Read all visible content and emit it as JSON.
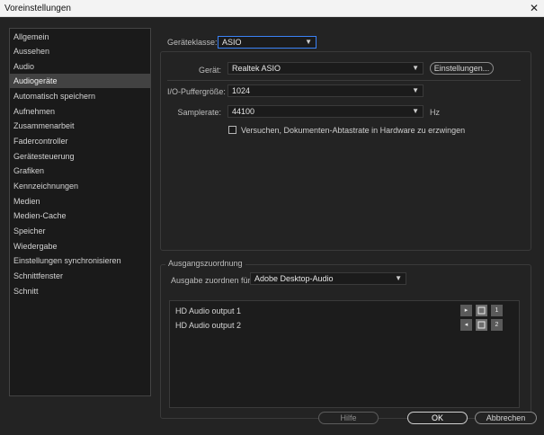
{
  "window": {
    "title": "Voreinstellungen",
    "close_glyph": "✕"
  },
  "sidebar": {
    "selected_index": 3,
    "items": [
      {
        "label": "Allgemein"
      },
      {
        "label": "Aussehen"
      },
      {
        "label": "Audio"
      },
      {
        "label": "Audiogeräte"
      },
      {
        "label": "Automatisch speichern"
      },
      {
        "label": "Aufnehmen"
      },
      {
        "label": "Zusammenarbeit"
      },
      {
        "label": "Fadercontroller"
      },
      {
        "label": "Gerätesteuerung"
      },
      {
        "label": "Grafiken"
      },
      {
        "label": "Kennzeichnungen"
      },
      {
        "label": "Medien"
      },
      {
        "label": "Medien-Cache"
      },
      {
        "label": "Speicher"
      },
      {
        "label": "Wiedergabe"
      },
      {
        "label": "Einstellungen synchronisieren"
      },
      {
        "label": "Schnittfenster"
      },
      {
        "label": "Schnitt"
      }
    ]
  },
  "device": {
    "class_label": "Geräteklasse:",
    "class_value": "ASIO",
    "device_label": "Gerät:",
    "device_value": "Realtek ASIO",
    "settings_button": "Einstellungen...",
    "buffer_label": "I/O-Puffergröße:",
    "buffer_value": "1024",
    "samplerate_label": "Samplerate:",
    "samplerate_value": "44100",
    "samplerate_unit": "Hz",
    "checkbox_label": "Versuchen, Dokumenten-Abtastrate in Hardware zu erzwingen",
    "checkbox_checked": false
  },
  "output": {
    "group_label": "Ausgangszuordnung",
    "map_label": "Ausgabe zuordnen für:",
    "map_value": "Adobe Desktop-Audio",
    "rows": [
      {
        "name": "HD Audio output 1",
        "channel": "1",
        "icon_glyph": "▸"
      },
      {
        "name": "HD Audio output 2",
        "channel": "2",
        "icon_glyph": "◂"
      }
    ]
  },
  "footer": {
    "help": "Hilfe",
    "ok": "OK",
    "cancel": "Abbrechen"
  },
  "icons": {
    "chevron": "chevron-down-icon",
    "bracket": "bracket-icon"
  }
}
